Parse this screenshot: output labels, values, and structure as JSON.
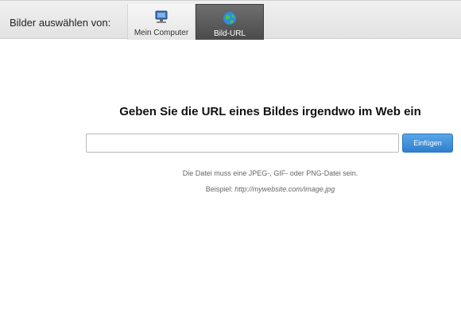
{
  "header": {
    "source_label": "Bilder auswählen von:",
    "tabs": [
      {
        "label": "Mein Computer",
        "icon": "computer-icon",
        "active": false
      },
      {
        "label": "Bild-URL",
        "icon": "globe-icon",
        "active": true
      }
    ]
  },
  "main": {
    "heading": "Geben Sie die URL eines Bildes irgendwo im Web ein",
    "url_input": {
      "value": "",
      "placeholder": ""
    },
    "insert_button": "Einfügen",
    "hint_format": "Die Datei muss eine JPEG-, GIF- oder PNG-Datei sein.",
    "hint_example_prefix": "Beispiel:",
    "hint_example_url": "http://mywebsite.com/image.jpg"
  },
  "colors": {
    "active_tab_bg": "#4b4b4b",
    "button_blue": "#2f7fcd"
  }
}
